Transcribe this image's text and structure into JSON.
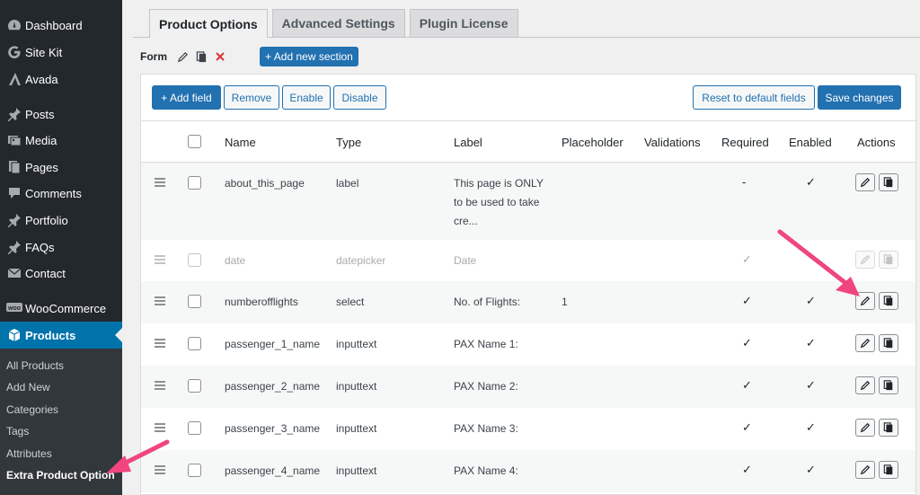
{
  "sidebar": {
    "items": [
      {
        "label": "Dashboard",
        "icon": "dashboard-icon"
      },
      {
        "label": "Site Kit",
        "icon": "site-kit-icon"
      },
      {
        "label": "Avada",
        "icon": "avada-icon"
      },
      {
        "label": "Posts",
        "icon": "pin-icon"
      },
      {
        "label": "Media",
        "icon": "media-icon"
      },
      {
        "label": "Pages",
        "icon": "pages-icon"
      },
      {
        "label": "Comments",
        "icon": "comments-icon"
      },
      {
        "label": "Portfolio",
        "icon": "pin-icon"
      },
      {
        "label": "FAQs",
        "icon": "pin-icon"
      },
      {
        "label": "Contact",
        "icon": "mail-icon"
      },
      {
        "label": "WooCommerce",
        "icon": "woocommerce-icon"
      },
      {
        "label": "Products",
        "icon": "box-icon"
      }
    ],
    "submenu": [
      "All Products",
      "Add New",
      "Categories",
      "Tags",
      "Attributes",
      "Extra Product Option"
    ],
    "active_color": "#0073aa"
  },
  "tabs": [
    "Product Options",
    "Advanced Settings",
    "Plugin License"
  ],
  "form": {
    "label": "Form",
    "add_section": "+ Add new section"
  },
  "toolbar": {
    "add_field": "+ Add field",
    "remove": "Remove",
    "enable": "Enable",
    "disable": "Disable",
    "reset": "Reset to default fields",
    "save": "Save changes"
  },
  "table": {
    "headers": {
      "name": "Name",
      "type": "Type",
      "label": "Label",
      "placeholder": "Placeholder",
      "validations": "Validations",
      "required": "Required",
      "enabled": "Enabled",
      "actions": "Actions"
    },
    "rows": [
      {
        "name": "about_this_page",
        "type": "label",
        "label_lines": [
          "This page is ONLY",
          "to be used to take",
          "cre..."
        ],
        "placeholder": "",
        "required": "-",
        "enabled": "✓",
        "disabled": false
      },
      {
        "name": "date",
        "type": "datepicker",
        "label_lines": [
          "Date"
        ],
        "placeholder": "",
        "required": "✓",
        "enabled": "",
        "disabled": true
      },
      {
        "name": "numberofflights",
        "type": "select",
        "label_lines": [
          "No. of Flights:"
        ],
        "placeholder": "1",
        "required": "✓",
        "enabled": "✓",
        "disabled": false
      },
      {
        "name": "passenger_1_name",
        "type": "inputtext",
        "label_lines": [
          "PAX Name 1:"
        ],
        "placeholder": "",
        "required": "✓",
        "enabled": "✓",
        "disabled": false
      },
      {
        "name": "passenger_2_name",
        "type": "inputtext",
        "label_lines": [
          "PAX Name 2:"
        ],
        "placeholder": "",
        "required": "✓",
        "enabled": "✓",
        "disabled": false
      },
      {
        "name": "passenger_3_name",
        "type": "inputtext",
        "label_lines": [
          "PAX Name 3:"
        ],
        "placeholder": "",
        "required": "✓",
        "enabled": "✓",
        "disabled": false
      },
      {
        "name": "passenger_4_name",
        "type": "inputtext",
        "label_lines": [
          "PAX Name 4:"
        ],
        "placeholder": "",
        "required": "✓",
        "enabled": "✓",
        "disabled": false
      }
    ]
  },
  "annotation_color": "#f0457e"
}
